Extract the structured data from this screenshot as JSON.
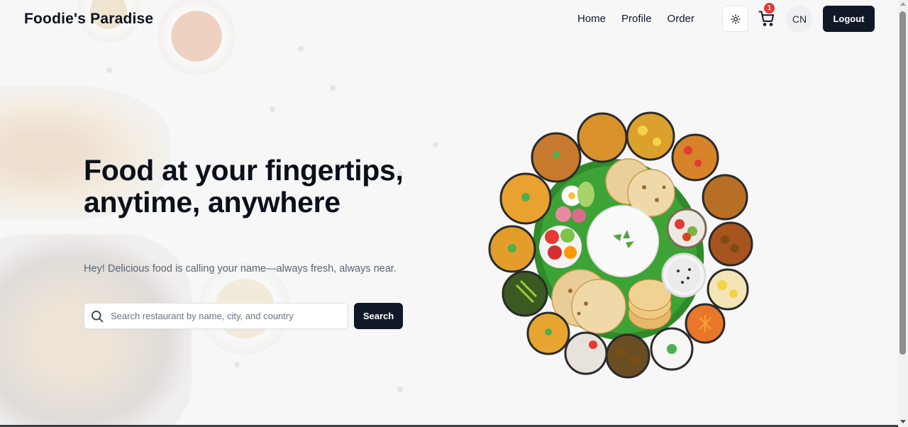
{
  "brand": "Foodie's Paradise",
  "nav": {
    "links": [
      "Home",
      "Profile",
      "Order"
    ],
    "theme_icon": "sun-icon",
    "cart_icon": "cart-icon",
    "cart_count": "1",
    "avatar_initials": "CN",
    "logout_label": "Logout"
  },
  "hero": {
    "title": "Food at your fingertips, anytime, anywhere",
    "subtitle": "Hey! Delicious food is calling your name—always fresh, always near.",
    "search_placeholder": "Search restaurant by name, city, and country",
    "search_value": "",
    "search_button": "Search"
  },
  "colors": {
    "primary": "#111827",
    "badge": "#e53935",
    "background": "#f7f7f8"
  }
}
